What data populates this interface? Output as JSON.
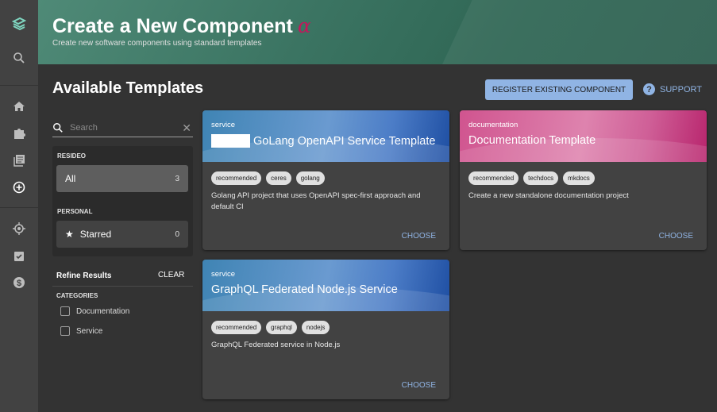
{
  "sidebar": {
    "items": [
      "logo",
      "search",
      "home",
      "catalog",
      "docs",
      "create",
      "tech-radar",
      "checklist",
      "cost"
    ]
  },
  "header": {
    "title": "Create a New Component",
    "alpha": "α",
    "subtitle": "Create new software components using standard templates"
  },
  "main": {
    "heading": "Available Templates",
    "register_label": "REGISTER EXISTING COMPONENT",
    "support_label": "SUPPORT"
  },
  "filters": {
    "search_placeholder": "Search",
    "groups": [
      {
        "label": "RESIDEO",
        "items": [
          {
            "label": "All",
            "count": "3",
            "selected": true
          }
        ]
      },
      {
        "label": "PERSONAL",
        "items": [
          {
            "label": "Starred",
            "count": "0",
            "icon": "star-icon"
          }
        ]
      }
    ],
    "refine_label": "Refine Results",
    "clear_label": "CLEAR",
    "categories_label": "CATEGORIES",
    "categories": [
      {
        "label": "Documentation",
        "checked": false
      },
      {
        "label": "Service",
        "checked": false
      }
    ]
  },
  "cards": [
    {
      "type": "service",
      "title": "GoLang OpenAPI Service Template",
      "tags": [
        "recommended",
        "ceres",
        "golang"
      ],
      "description": "Golang API project that uses OpenAPI spec-first approach and default CI",
      "choose": "CHOOSE",
      "color": "#4c7dc7"
    },
    {
      "type": "documentation",
      "title": "Documentation Template",
      "tags": [
        "recommended",
        "techdocs",
        "mkdocs"
      ],
      "description": "Create a new standalone documentation project",
      "choose": "CHOOSE",
      "color": "#cf5f97"
    },
    {
      "type": "service",
      "title": "GraphQL Federated Node.js Service",
      "tags": [
        "recommended",
        "graphql",
        "nodejs"
      ],
      "description": "GraphQL Federated service in Node.js",
      "choose": "CHOOSE",
      "color": "#4c7dc7"
    }
  ]
}
